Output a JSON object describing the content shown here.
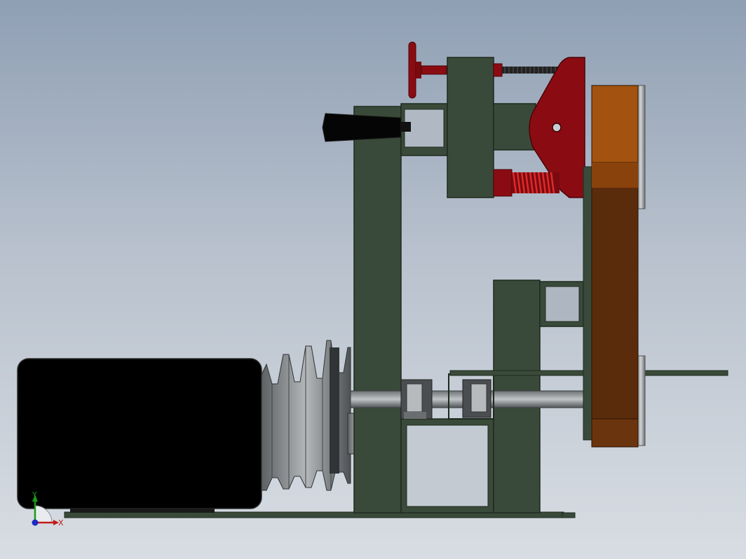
{
  "scene": {
    "colors": {
      "frame_green": "#3a4a3a",
      "frame_edge": "#1e2a1e",
      "handwheel_red": "#8a0c12",
      "belt_orange": "#a3520f",
      "belt_brown": "#5a2c0c",
      "motor_black": "#000000",
      "pulley_gray": "#8a8e90"
    },
    "triad": {
      "y_label": "Y",
      "x_label": "X",
      "y_color": "#1a9a1a",
      "x_color": "#c21a1a",
      "z_color": "#1a2ac2"
    },
    "components": {
      "motor": "motor-body",
      "pulley": "stepped-pulley",
      "frame": "main-frame",
      "tension_arm": "tension-arm",
      "belt": "sanding-belt",
      "handwheel": "tension-handwheel",
      "spring": "tension-spring",
      "knob": "tilt-knob"
    }
  }
}
